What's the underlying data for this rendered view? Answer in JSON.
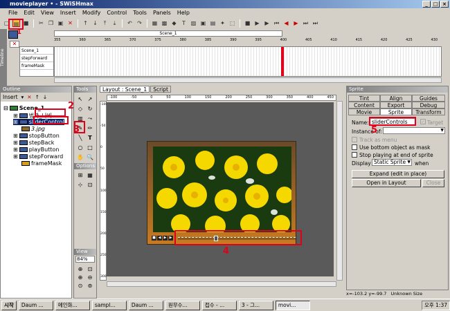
{
  "window": {
    "title": "movieplayer • - SWiSHmax"
  },
  "menu": [
    "File",
    "Edit",
    "View",
    "Insert",
    "Modify",
    "Control",
    "Tools",
    "Panels",
    "Help"
  ],
  "timeline": {
    "scene_label": "Scene_1",
    "ruler": [
      "355",
      "360",
      "365",
      "370",
      "375",
      "380",
      "385",
      "390",
      "395",
      "400",
      "405",
      "410",
      "415",
      "420",
      "425",
      "430"
    ],
    "rows": [
      "Scene_1",
      "stepForward",
      "frameMask"
    ],
    "vertical_label": "Timeline"
  },
  "outline": {
    "title": "Outline",
    "insert_label": "Insert",
    "items": [
      "Scene_1",
      "벙과_나비",
      "sliderControl",
      "3.jpg",
      "stopButton",
      "stepBack",
      "playButton",
      "stepForward",
      "frameMask"
    ]
  },
  "tools": {
    "title": "Tools",
    "options": "Options",
    "view": "View",
    "zoom": "84%"
  },
  "layout": {
    "tabs": [
      "Layout : Scene_1",
      "Script"
    ],
    "ruler": [
      "-100",
      "-50",
      "0",
      "50",
      "100",
      "150",
      "200",
      "250",
      "300",
      "350",
      "400",
      "450"
    ],
    "vruler": [
      "-100",
      "-50",
      "0",
      "50",
      "100",
      "150",
      "200",
      "250",
      "300"
    ]
  },
  "sprite_panel": {
    "title": "Sprite",
    "tabs_row1": [
      "Tint",
      "Align",
      "Guides"
    ],
    "tabs_row2": [
      "Content",
      "Export",
      "Debug"
    ],
    "tabs_row3": [
      "Movie",
      "Sprite",
      "Transform"
    ],
    "name_label": "Name:",
    "name_value": "sliderControls",
    "target_label": "Target",
    "instance_label": "Instance of:",
    "track_menu": "Track as menu",
    "use_bottom": "Use bottom object as mask",
    "stop_playing": "Stop playing at end of sprite",
    "display_label": "Display",
    "display_value": "Static Sprite",
    "when_label": "when",
    "expand_btn": "Expand (edit in place)",
    "open_btn": "Open in Layout",
    "close_btn": "Close"
  },
  "status": {
    "coords": "x=-103.2 y=-99.7",
    "size": "Unknown Size"
  },
  "annotations": [
    "1",
    "2",
    "3",
    "4",
    "5"
  ],
  "taskbar": {
    "start": "시작",
    "items": [
      "Daum ...",
      "메인화...",
      "sampl...",
      "Daum ...",
      "원무수...",
      "접수 - ...",
      "3 - 그...",
      "movi..."
    ],
    "clock": "오후 1:37"
  },
  "colors": {
    "accent": "#e0001a",
    "title_start": "#0a246a",
    "title_end": "#a6caf0"
  }
}
